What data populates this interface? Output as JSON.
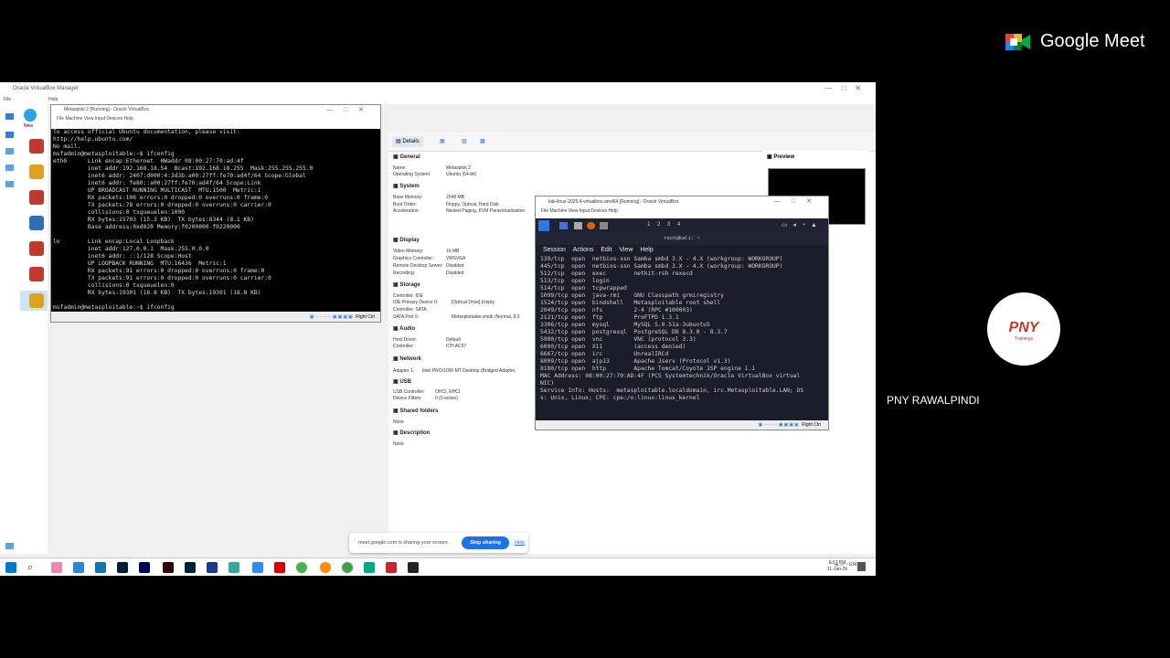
{
  "meet": {
    "title": "Google Meet",
    "participant_name": "PNY RAWALPINDI",
    "avatar_text": "PNY",
    "avatar_subtext": "Trainings"
  },
  "vbox_manager": {
    "title": "Oracle VirtualBox Manager",
    "menu": [
      "File",
      "Machine",
      "Help"
    ],
    "toolbar": [
      "New",
      "Op"
    ],
    "tabs": [
      "Details"
    ],
    "preview_label": "Preview",
    "sections": {
      "general": {
        "title": "General",
        "rows": [
          [
            "Name:",
            "Metasploit 2"
          ],
          [
            "Operating System:",
            "Ubuntu (64-bit)"
          ]
        ]
      },
      "system": {
        "title": "System",
        "rows": [
          [
            "Base Memory:",
            "2048 MB"
          ],
          [
            "Boot Order:",
            "Floppy, Optical, Hard Disk"
          ],
          [
            "Acceleration:",
            "Nested Paging, KVM Paravirtualization"
          ]
        ]
      },
      "display": {
        "title": "Display",
        "rows": [
          [
            "Video Memory:",
            "16 MB"
          ],
          [
            "Graphics Controller:",
            "VMSVGA"
          ],
          [
            "Remote Desktop Server:",
            "Disabled"
          ],
          [
            "Recording:",
            "Disabled"
          ]
        ]
      },
      "storage": {
        "title": "Storage",
        "rows": [
          [
            "Controller: IDE",
            ""
          ],
          [
            "IDE Primary Device 0:",
            "[Optical Drive] Empty"
          ],
          [
            "Controller: SATA",
            ""
          ],
          [
            "SATA Port 0:",
            "Metasploitable.vmdk (Normal, 8.0"
          ]
        ]
      },
      "audio": {
        "title": "Audio",
        "rows": [
          [
            "Host Driver:",
            "Default"
          ],
          [
            "Controller:",
            "ICH AC97"
          ]
        ]
      },
      "network": {
        "title": "Network",
        "rows": [
          [
            "Adapter 1:",
            "Intel PRO/1000 MT Desktop (Bridged Adapter,"
          ]
        ]
      },
      "usb": {
        "title": "USB",
        "rows": [
          [
            "USB Controller:",
            "OHCI, EHCI"
          ],
          [
            "Device Filters:",
            "0 (0 active)"
          ]
        ]
      },
      "shared": {
        "title": "Shared folders",
        "rows": [
          [
            "None",
            ""
          ]
        ]
      },
      "description": {
        "title": "Description",
        "rows": [
          [
            "None",
            ""
          ]
        ]
      }
    }
  },
  "msf_window": {
    "title": "Metasploit 2 [Running] - Oracle VirtualBox",
    "menu": "File   Machine   View   Input   Devices   Help",
    "status": "Right Ctrl",
    "lines": [
      "To access official Ubuntu documentation, please visit:",
      "http://help.ubuntu.com/",
      "No mail.",
      "msfadmin@metasploitable:~$ ifconfig",
      "eth0      Link encap:Ethernet  HWaddr 08:00:27:70:ad:4f",
      "          inet addr:192.168.18.54  Bcast:192.168.18.255  Mask:255.255.255.0",
      "          inet6 addr: 2407:d000:4:3d3b:a00:27ff:fe70:ad4f/64 Scope:Global",
      "          inet6 addr: fe80::a00:27ff:fe70:ad4f/64 Scope:Link",
      "          UP BROADCAST RUNNING MULTICAST  MTU:1500  Metric:1",
      "          RX packets:106 errors:0 dropped:0 overruns:0 frame:0",
      "          TX packets:78 errors:0 dropped:0 overruns:0 carrier:0",
      "          collisions:0 txqueuelen:1000",
      "          RX bytes:15703 (15.3 KB)  TX bytes:8344 (8.1 KB)",
      "          Base address:0xd020 Memory:f0200000-f0220000",
      "",
      "lo        Link encap:Local Loopback",
      "          inet addr:127.0.0.1  Mask:255.0.0.0",
      "          inet6 addr: ::1/128 Scope:Host",
      "          UP LOOPBACK RUNNING  MTU:16436  Metric:1",
      "          RX packets:91 errors:0 dropped:0 overruns:0 frame:0",
      "          TX packets:91 errors:0 dropped:0 overruns:0 carrier:0",
      "          collisions:0 txqueuelen:0",
      "          RX bytes:19301 (18.8 KB)  TX bytes:19301 (18.8 KB)",
      "",
      "msfadmin@metasploitable:~$ ifconfig"
    ]
  },
  "kali_window": {
    "title": "kali-linux-2025.4-virtualbox-amd64 [Running] - Oracle VirtualBox",
    "menu": "File   Machine   View   Input   Devices   Help",
    "term_title": "root@kali: ~",
    "term_menu": "Session Actions Edit View Help",
    "workspaces": "1   2   3   4",
    "status": "Right Ctrl",
    "lines": [
      "139/tcp  open  netbios-ssn Samba smbd 3.X - 4.X (workgroup: WORKGROUP)",
      "445/tcp  open  netbios-ssn Samba smbd 3.X - 4.X (workgroup: WORKGROUP)",
      "512/tcp  open  exec        netkit-rsh rexecd",
      "513/tcp  open  login",
      "514/tcp  open  tcpwrapped",
      "1099/tcp open  java-rmi    GNU Classpath grmiregistry",
      "1524/tcp open  bindshell   Metasploitable root shell",
      "2049/tcp open  nfs         2-4 (RPC #100003)",
      "2121/tcp open  ftp         ProFTPD 1.3.1",
      "3306/tcp open  mysql       MySQL 5.0.51a-3ubuntu5",
      "5432/tcp open  postgresql  PostgreSQL DB 8.3.0 - 8.3.7",
      "5900/tcp open  vnc         VNC (protocol 3.3)",
      "6000/tcp open  X11         (access denied)",
      "6667/tcp open  irc         UnrealIRCd",
      "8009/tcp open  ajp13       Apache Jserv (Protocol v1.3)",
      "8180/tcp open  http        Apache Tomcat/Coyote JSP engine 1.1",
      "MAC Address: 08:00:27:70:AD:4F (PCS Systemtechnik/Oracle VirtualBox virtual",
      "NIC)",
      "Service Info: Hosts:  metasploitable.localdomain, irc.Metasploitable.LAN; OS",
      "s: Unix, Linux; CPE: cpe:/o:linux:linux_kernel"
    ]
  },
  "share_bar": {
    "text": "meet.google.com is sharing your screen.",
    "stop": "Stop sharing",
    "hide": "Hide"
  },
  "taskbar": {
    "lang": "ENG",
    "time": "6:57 PM",
    "date": "11-Jan-26"
  },
  "colors": {
    "meet_blue": "#1a73e8",
    "kali_bg": "#1b1d2a"
  }
}
